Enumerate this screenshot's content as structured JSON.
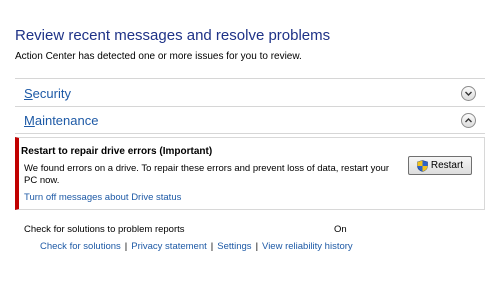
{
  "header": {
    "title": "Review recent messages and resolve problems",
    "subtitle": "Action Center has detected one or more issues for you to review."
  },
  "sections": {
    "security": {
      "label_first": "S",
      "label_rest": "ecurity",
      "state": "collapsed"
    },
    "maintenance": {
      "label_first": "M",
      "label_rest": "aintenance",
      "state": "expanded"
    }
  },
  "alert": {
    "title": "Restart to repair drive errors (Important)",
    "body": "We found errors on a drive. To repair these errors and prevent loss of data, restart your PC now.",
    "link": "Turn off messages about Drive status",
    "button_label": "Restart",
    "severity_color": "#c00000"
  },
  "problem_reports": {
    "label": "Check for solutions to problem reports",
    "value": "On",
    "links": [
      "Check for solutions",
      "Privacy statement",
      "Settings",
      "View reliability history"
    ]
  },
  "colors": {
    "title": "#1e3287",
    "link": "#1e5aa6",
    "alert_bar": "#c00000"
  }
}
